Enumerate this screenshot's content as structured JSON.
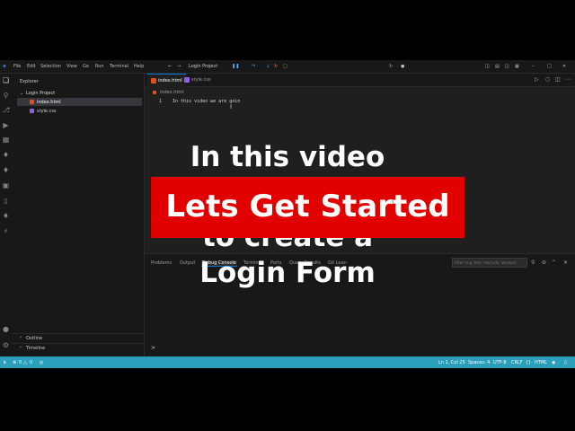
{
  "titlebar": {
    "menus": [
      "File",
      "Edit",
      "Selection",
      "View",
      "Go",
      "Run",
      "Terminal",
      "Help"
    ],
    "search_text": "Login Project"
  },
  "sidebar": {
    "header": "Explorer",
    "folder": "Login Project",
    "files": [
      "index.html",
      "style.css"
    ],
    "outline": "Outline",
    "timeline": "Timeline"
  },
  "editor": {
    "tabs": [
      "index.html",
      "style.css"
    ],
    "breadcrumb": "index.html",
    "line_number": "1",
    "code_line": "In this video we are goin"
  },
  "panel": {
    "tabs": [
      "Problems",
      "Output",
      "Debug Console",
      "Terminal",
      "Ports",
      "Query Results",
      "Git Lean"
    ],
    "filter_placeholder": "Filter (e.g. text, !exclude, \\escape)",
    "prompt": ">"
  },
  "statusbar": {
    "errors": "0",
    "warnings": "0",
    "ports": "0",
    "position": "Ln 1, Col 25",
    "spaces": "Spaces: 4",
    "encoding": "UTF-8",
    "eol": "CRLF",
    "language": "HTML"
  },
  "overlay": {
    "line1": "In this video",
    "banner": "Lets Get Started",
    "line3": "to create a",
    "line4": "Login Form"
  },
  "colors": {
    "accent": "#0078d4",
    "statusbar": "#2b9fb9",
    "banner": "#e00000",
    "html_icon": "#e44d26",
    "css_icon": "#8f5de8"
  }
}
